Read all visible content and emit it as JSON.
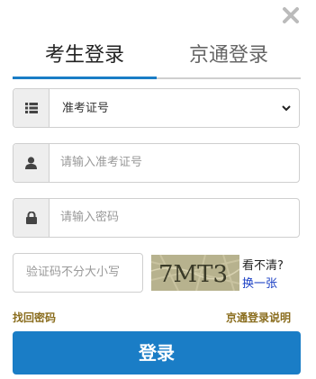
{
  "dialog": {
    "close_icon": "close-icon"
  },
  "tabs": [
    {
      "label": "考生登录",
      "active": true
    },
    {
      "label": "京通登录",
      "active": false
    }
  ],
  "id_type": {
    "icon": "list-icon",
    "selected": "准考证号",
    "options": [
      "准考证号"
    ]
  },
  "username": {
    "icon": "user-icon",
    "placeholder": "请输入准考证号",
    "value": ""
  },
  "password": {
    "icon": "lock-icon",
    "placeholder": "请输入密码",
    "value": ""
  },
  "captcha": {
    "placeholder": "验证码不分大小写",
    "value": "",
    "image_text": "7MT3",
    "help_text": "看不清?",
    "refresh_text": "换一张"
  },
  "links": {
    "forgot_password": "找回密码",
    "jingtong_help": "京通登录说明"
  },
  "login_button": {
    "label": "登录"
  },
  "colors": {
    "accent": "#1a7dc6",
    "link": "#8a6d1e",
    "refresh_link": "#1a3fc4"
  }
}
